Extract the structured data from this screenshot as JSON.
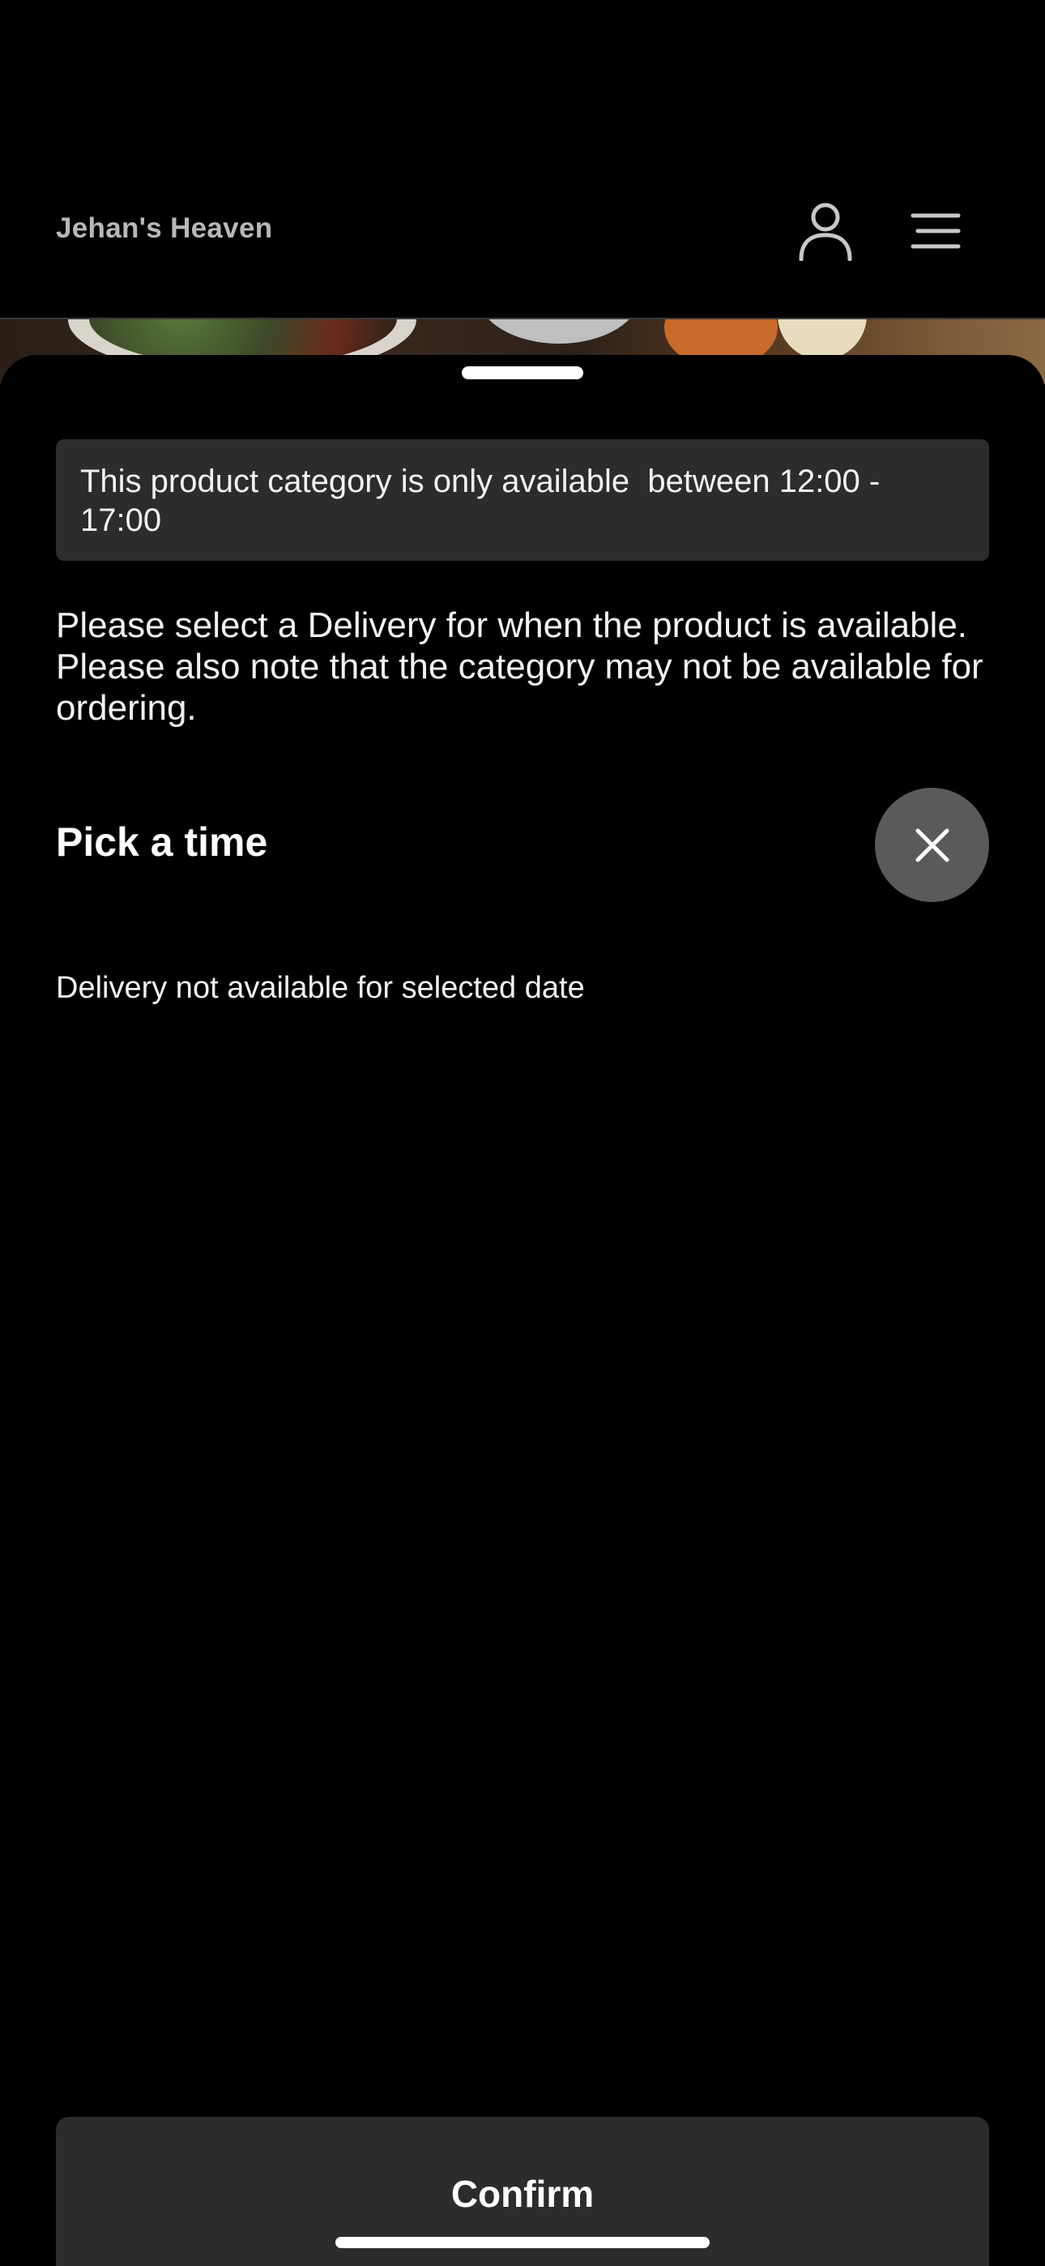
{
  "header": {
    "brand": "Jehan's Heaven",
    "profile_icon": "person-icon",
    "menu_icon": "hamburger-menu-icon"
  },
  "sheet": {
    "notice": "This product category is only available  between 12:00 - 17:00",
    "instructions": "Please select a Delivery for when the product is available. Please also note that the category may not be available for ordering.",
    "pick_title": "Pick a time",
    "close_icon": "close-icon",
    "unavailable_message": "Delivery not available for selected date",
    "confirm_label": "Confirm"
  },
  "colors": {
    "background": "#000000",
    "panel": "#2c2c2e",
    "close_button": "#5a5a5a",
    "brand_text": "#b8b8b8",
    "text": "#ffffff"
  }
}
